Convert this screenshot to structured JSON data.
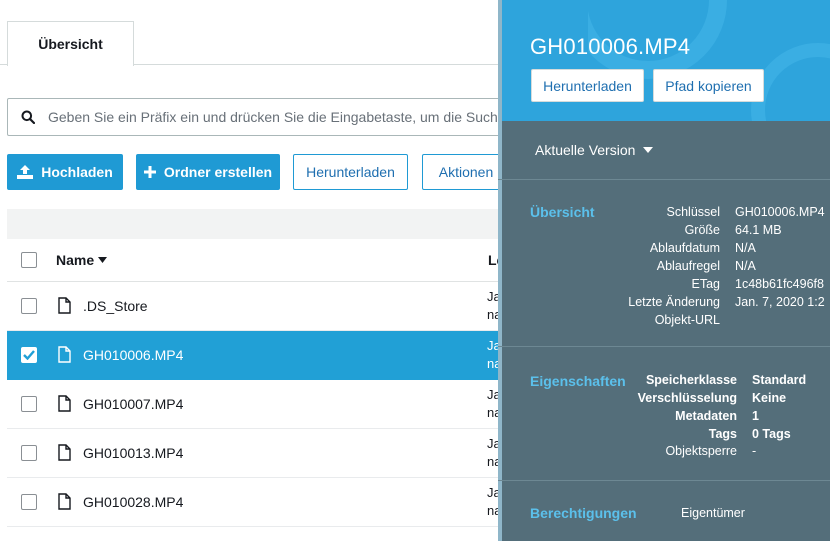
{
  "tab": {
    "label": "Übersicht"
  },
  "search": {
    "placeholder": "Geben Sie ein Präfix ein und drücken Sie die Eingabetaste, um die Suche zu starten."
  },
  "toolbar": {
    "upload_label": "Hochladen",
    "new_folder_label": "Ordner erstellen",
    "download_label": "Herunterladen",
    "actions_label": "Aktionen"
  },
  "table": {
    "col_name": "Name",
    "col_last": "Le",
    "rows": [
      {
        "name": ".DS_Store",
        "trunc1": "Ja",
        "trunc2": "na",
        "selected": false
      },
      {
        "name": "GH010006.MP4",
        "trunc1": "Ja",
        "trunc2": "na",
        "selected": true
      },
      {
        "name": "GH010007.MP4",
        "trunc1": "Ja",
        "trunc2": "na",
        "selected": false
      },
      {
        "name": "GH010013.MP4",
        "trunc1": "Ja",
        "trunc2": "na",
        "selected": false
      },
      {
        "name": "GH010028.MP4",
        "trunc1": "Ja",
        "trunc2": "na",
        "selected": false
      }
    ]
  },
  "panel": {
    "title": "GH010006.MP4",
    "download_label": "Herunterladen",
    "copy_path_label": "Pfad kopieren",
    "version_label": "Aktuelle Version",
    "overview": {
      "title": "Übersicht",
      "items": [
        {
          "key": "Schlüssel",
          "value": "GH010006.MP4"
        },
        {
          "key": "Größe",
          "value": "64.1 MB"
        },
        {
          "key": "Ablaufdatum",
          "value": "N/A"
        },
        {
          "key": "Ablaufregel",
          "value": "N/A"
        },
        {
          "key": "ETag",
          "value": "1c48b61fc496f8"
        },
        {
          "key": "Letzte Änderung",
          "value": "Jan. 7, 2020 1:2"
        },
        {
          "key": "Objekt-URL",
          "value": ""
        }
      ]
    },
    "properties": {
      "title": "Eigenschaften",
      "items": [
        {
          "key": "Speicherklasse",
          "value": "Standard"
        },
        {
          "key": "Verschlüsselung",
          "value": "Keine"
        },
        {
          "key": "Metadaten",
          "value": "1"
        },
        {
          "key": "Tags",
          "value": "0 Tags"
        },
        {
          "key": "Objektsperre",
          "value": "-"
        }
      ]
    },
    "permissions": {
      "title": "Berechtigungen",
      "owner_label": "Eigentümer"
    }
  },
  "colors": {
    "accent": "#1f9ad4",
    "selected_row": "#21a0d6",
    "panel_bg": "#546e7a",
    "panel_header": "#2ea4dc",
    "section_title": "#5bc0eb"
  }
}
